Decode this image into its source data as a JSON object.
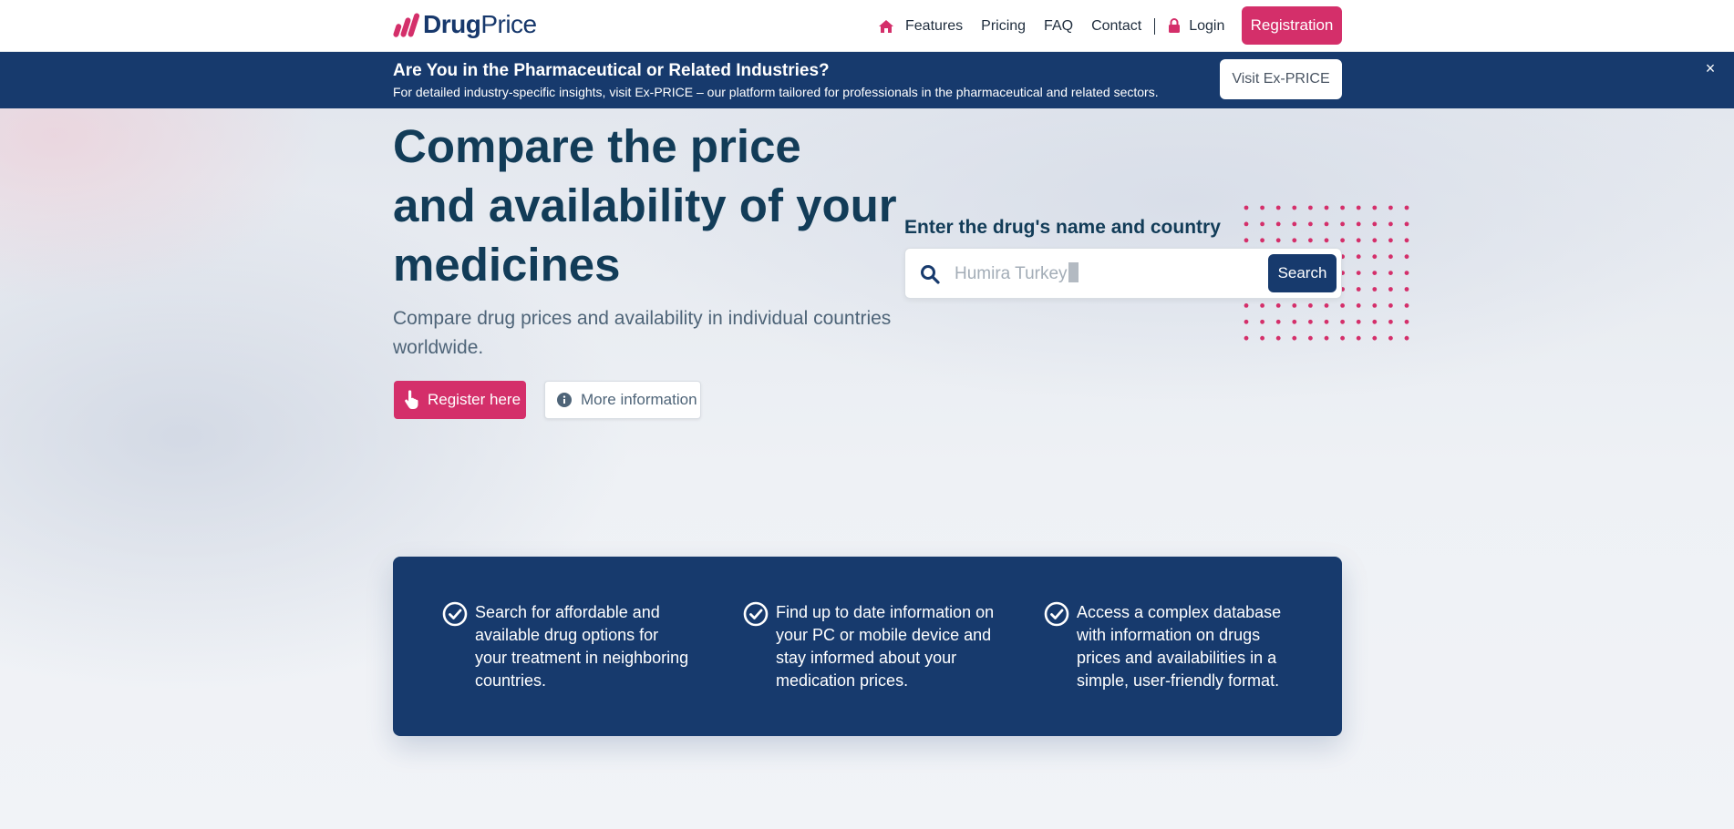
{
  "nav": {
    "logo": {
      "part1": "Drug",
      "part2": "Price"
    },
    "home_icon": "home-icon",
    "links": [
      "Features",
      "Pricing",
      "FAQ",
      "Contact"
    ],
    "login": "Login",
    "lock_icon": "lock-icon",
    "registration": "Registration"
  },
  "banner": {
    "title": "Are You in the Pharmaceutical or Related Industries?",
    "text": "For detailed industry-specific insights, visit Ex-PRICE – our platform tailored for professionals in the pharmaceutical and related sectors.",
    "button": "Visit Ex-PRICE",
    "close": "×"
  },
  "hero": {
    "title_lines": [
      "Compare the price",
      "and availability of your",
      "medicines"
    ],
    "subtitle": "Compare drug prices and availability in individual countries worldwide.",
    "register_button": "Register here",
    "more_button": "More information"
  },
  "search": {
    "label": "Enter the drug's name and country",
    "placeholder": "Humira Turkey",
    "button": "Search"
  },
  "features": [
    {
      "text": "Search for affordable and available drug options for your treatment in neighboring countries."
    },
    {
      "text": "Find up to date information on your PC or mobile device and stay informed about your medication prices."
    },
    {
      "text": "Access a complex database with information on drugs prices and availabilities in a simple, user-friendly format."
    }
  ],
  "colors": {
    "brand_pink": "#d42f6a",
    "brand_navy": "#173a6d",
    "heading": "#123c58"
  }
}
